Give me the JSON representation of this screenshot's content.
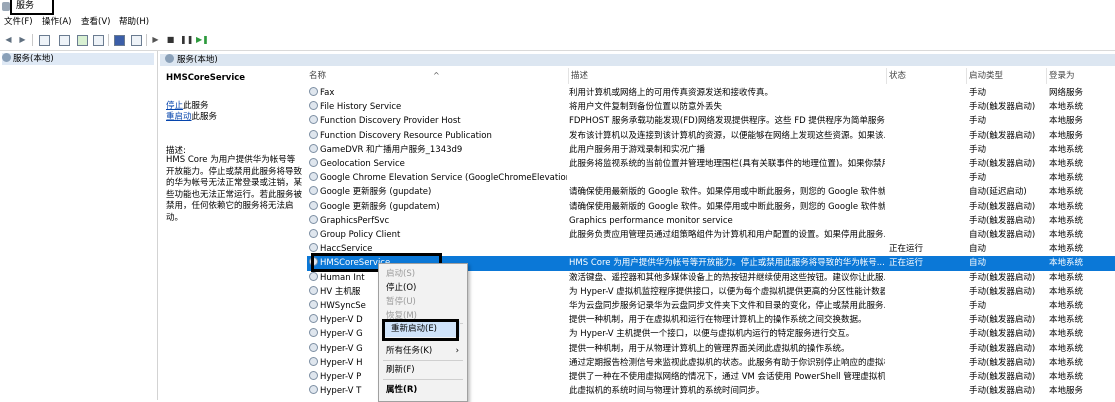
{
  "window": {
    "title": "服务"
  },
  "menu": [
    "文件(F)",
    "操作(A)",
    "查看(V)",
    "帮助(H)"
  ],
  "toolbar": {
    "icons": [
      "back-icon",
      "forward-icon",
      "console-tree-icon",
      "properties-icon",
      "refresh-icon",
      "export-icon",
      "help-icon",
      "view-icon",
      "play-icon",
      "stop-icon",
      "pause-icon",
      "restart-icon"
    ]
  },
  "tree": {
    "root": "服务(本地)"
  },
  "header": {
    "title": "服务(本地)"
  },
  "desc": {
    "service_name": "HMSCoreService",
    "stop_link": "停止",
    "stop_suffix": "此服务",
    "restart_link": "重启动",
    "restart_suffix": "此服务",
    "label": "描述:",
    "body": "HMS Core 为用户提供华为帐号等开放能力。停止或禁用此服务将导致的华为帐号无法正常登录或注销，某些功能也无法正常运行。若此服务被禁用，任何依赖它的服务将无法启动。"
  },
  "columns": [
    "名称",
    "描述",
    "状态",
    "启动类型",
    "登录为"
  ],
  "rows": [
    {
      "name": "Fax",
      "desc": "利用计算机或网络上的可用传真资源发送和接收传真。",
      "status": "",
      "startup": "手动",
      "logon": "网络服务"
    },
    {
      "name": "File History Service",
      "desc": "将用户文件复制到备份位置以防意外丢失",
      "status": "",
      "startup": "手动(触发器启动)",
      "logon": "本地系统"
    },
    {
      "name": "Function Discovery Provider Host",
      "desc": "FDPHOST 服务承载功能发现(FD)网络发现提供程序。这些 FD 提供程序为简单服务发...",
      "status": "",
      "startup": "手动",
      "logon": "本地服务"
    },
    {
      "name": "Function Discovery Resource Publication",
      "desc": "发布该计算机以及连接到该计算机的资源，以便能够在网络上发现这些资源。如果该...",
      "status": "",
      "startup": "手动(触发器启动)",
      "logon": "本地服务"
    },
    {
      "name": "GameDVR 和广播用户服务_1343d9",
      "desc": "此用户服务用于游戏录制和实况广播",
      "status": "",
      "startup": "手动",
      "logon": "本地系统"
    },
    {
      "name": "Geolocation Service",
      "desc": "此服务将监视系统的当前位置并管理地理围栏(具有关联事件的地理位置)。如果你禁用...",
      "status": "",
      "startup": "手动(触发器启动)",
      "logon": "本地系统"
    },
    {
      "name": "Google Chrome Elevation Service (GoogleChromeElevationS...",
      "desc": "",
      "status": "",
      "startup": "手动",
      "logon": "本地系统"
    },
    {
      "name": "Google 更新服务 (gupdate)",
      "desc": "请确保使用最新版的 Google 软件。如果停用或中断此服务，则您的 Google 软件就...",
      "status": "",
      "startup": "自动(延迟启动)",
      "logon": "本地系统"
    },
    {
      "name": "Google 更新服务 (gupdatem)",
      "desc": "请确保使用最新版的 Google 软件。如果停用或中断此服务，则您的 Google 软件就...",
      "status": "",
      "startup": "手动(触发器启动)",
      "logon": "本地系统"
    },
    {
      "name": "GraphicsPerfSvc",
      "desc": "Graphics performance monitor service",
      "status": "",
      "startup": "手动(触发器启动)",
      "logon": "本地系统"
    },
    {
      "name": "Group Policy Client",
      "desc": "此服务负责应用管理员通过组策略组件为计算机和用户配置的设置。如果停用此服务...",
      "status": "",
      "startup": "自动(触发器启动)",
      "logon": "本地系统"
    },
    {
      "name": "HaccService",
      "desc": "",
      "status": "正在运行",
      "startup": "自动",
      "logon": "本地系统"
    },
    {
      "name": "HMSCoreService",
      "desc": "HMS Core 为用户提供华为帐号等开放能力。停止或禁用此服务将导致的华为帐号...",
      "status": "正在运行",
      "startup": "自动",
      "logon": "本地系统"
    },
    {
      "name": "Human Int",
      "desc": "激活键盘、遥控器和其他多媒体设备上的热按钮并继续使用这些按钮。建议你让此服...",
      "status": "",
      "startup": "手动(触发器启动)",
      "logon": "本地系统"
    },
    {
      "name": "HV 主机服",
      "desc": "为 Hyper-V 虚拟机监控程序提供接口，以便为每个虚拟机提供更高的分区性能计数器。",
      "status": "",
      "startup": "手动(触发器启动)",
      "logon": "本地系统"
    },
    {
      "name": "HWSyncSe",
      "desc": "华为云盘同步服务记录华为云盘同步文件夹下文件和目录的变化，停止或禁用此服务...",
      "status": "",
      "startup": "手动",
      "logon": "本地系统"
    },
    {
      "name": "Hyper-V D",
      "desc": "提供一种机制，用于在虚拟机和运行在物理计算机上的操作系统之间交换数据。",
      "status": "",
      "startup": "手动(触发器启动)",
      "logon": "本地系统"
    },
    {
      "name": "Hyper-V G",
      "desc": "为 Hyper-V 主机提供一个接口，以便与虚拟机内运行的特定服务进行交互。",
      "status": "",
      "startup": "手动(触发器启动)",
      "logon": "本地系统"
    },
    {
      "name": "Hyper-V G",
      "desc": "提供一种机制，用于从物理计算机上的管理界面关闭此虚拟机的操作系统。",
      "status": "",
      "startup": "手动(触发器启动)",
      "logon": "本地系统"
    },
    {
      "name": "Hyper-V H",
      "desc": "通过定期报告检测信号来监视此虚拟机的状态。此服务有助于你识别停止响应的虚拟机。",
      "status": "",
      "startup": "手动(触发器启动)",
      "logon": "本地系统"
    },
    {
      "name": "Hyper-V P",
      "desc": "提供了一种在不使用虚拟网络的情况下，通过 VM 会话使用 PowerShell 管理虚拟机...",
      "status": "",
      "startup": "手动(触发器启动)",
      "logon": "本地系统"
    },
    {
      "name": "Hyper-V T",
      "desc": "此虚拟机的系统时间与物理计算机的系统时间同步。",
      "status": "",
      "startup": "手动(触发器启动)",
      "logon": "本地服务"
    }
  ],
  "context_menu": {
    "items": [
      {
        "label": "启动(S)",
        "state": "disabled"
      },
      {
        "label": "停止(O)",
        "state": "normal"
      },
      {
        "label": "暂停(U)",
        "state": "disabled"
      },
      {
        "label": "恢复(M)",
        "state": "disabled"
      },
      {
        "label": "重新启动(E)",
        "state": "highlighted"
      },
      {
        "label": "所有任务(K)",
        "state": "normal",
        "submenu": "›"
      },
      {
        "label": "刷新(F)",
        "state": "normal"
      },
      {
        "label": "属性(R)",
        "state": "bold"
      }
    ]
  },
  "colors": {
    "selection": "#0b78d7",
    "header_bg": "#dce6f1",
    "link": "#0645ad",
    "menu_highlight": "#cfe3fa"
  }
}
